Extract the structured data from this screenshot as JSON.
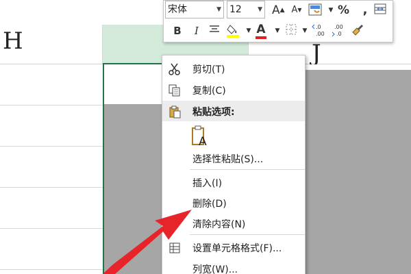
{
  "sheet": {
    "columns": [
      {
        "letter": "H"
      },
      {
        "letter": ""
      },
      {
        "letter": "J"
      }
    ]
  },
  "mini_toolbar": {
    "font_name": "宋体",
    "font_size": "12",
    "buttons_row1": {
      "grow_font": "A",
      "shrink_font": "A",
      "percent": "%",
      "comma": ","
    },
    "buttons_row2": {
      "bold": "B",
      "italic": "I",
      "font_color_letter": "A"
    },
    "colors": {
      "highlight": "#ffff00",
      "font_color": "#e02020"
    }
  },
  "context_menu": {
    "items": [
      {
        "label": "剪切(T)",
        "icon": "scissors-icon"
      },
      {
        "label": "复制(C)",
        "icon": "copy-icon"
      },
      {
        "label": "粘贴选项:",
        "icon": "clipboard-icon"
      },
      {
        "label": "",
        "icon": "paste-keep-text-icon"
      },
      {
        "label": "选择性粘贴(S)...",
        "icon": ""
      },
      {
        "label": "插入(I)",
        "icon": ""
      },
      {
        "label": "删除(D)",
        "icon": ""
      },
      {
        "label": "清除内容(N)",
        "icon": ""
      },
      {
        "label": "设置单元格格式(F)...",
        "icon": "format-cells-icon"
      },
      {
        "label": "列宽(W)...",
        "icon": ""
      }
    ],
    "paste_icon_letter": "A"
  },
  "colors": {
    "selection_header": "#d3eadb",
    "selection_border": "#217346",
    "selected_fill": "#a6a6a6",
    "arrow": "#e8242b"
  }
}
